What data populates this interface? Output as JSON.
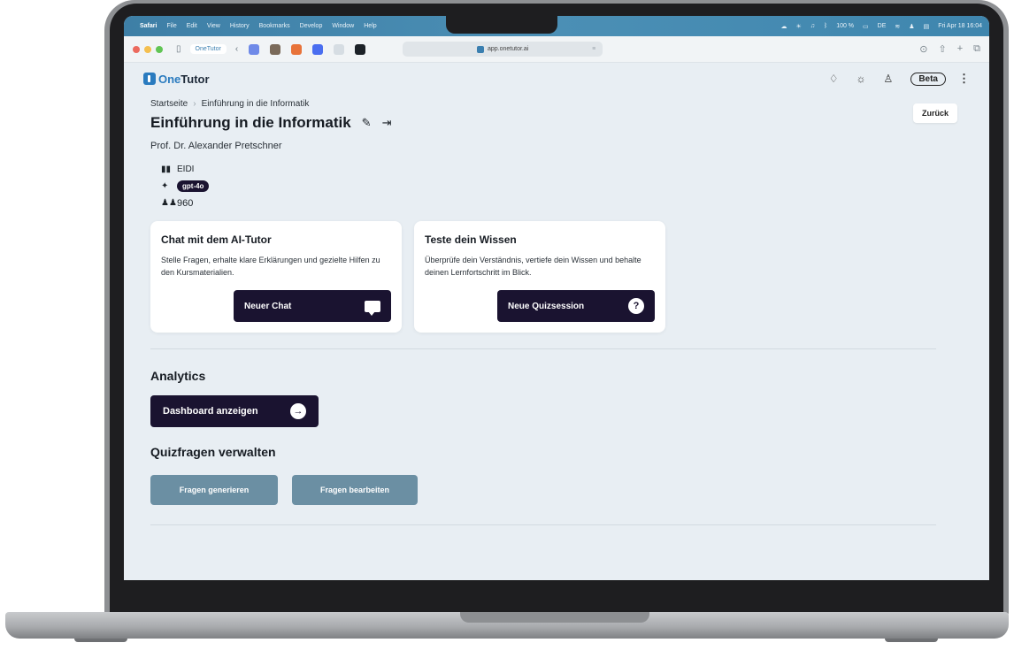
{
  "menubar": {
    "app": "Safari",
    "items": [
      "File",
      "Edit",
      "View",
      "History",
      "Bookmarks",
      "Develop",
      "Window",
      "Help"
    ],
    "battery": "100 %",
    "input_source": "DE",
    "datetime": "Fri Apr 18  16:04"
  },
  "browser": {
    "tab_group": "OneTutor",
    "url": "app.onetutor.ai"
  },
  "header": {
    "logo_part1": "One",
    "logo_part2": "Tutor",
    "beta": "Beta"
  },
  "breadcrumb": {
    "home": "Startseite",
    "current": "Einführung in die Informatik"
  },
  "course": {
    "title": "Einführung in die Informatik",
    "professor": "Prof. Dr. Alexander Pretschner",
    "code": "EIDI",
    "model": "gpt-4o",
    "students": "960"
  },
  "back_button": "Zurück",
  "cards": {
    "chat": {
      "title": "Chat mit dem AI-Tutor",
      "description": "Stelle Fragen, erhalte klare Erklärungen und gezielte Hilfen zu den Kursmaterialien.",
      "button": "Neuer Chat"
    },
    "quiz": {
      "title": "Teste dein Wissen",
      "description": "Überprüfe dein Verständnis, vertiefe dein Wissen und behalte deinen Lernfortschritt im Blick.",
      "button": "Neue Quizsession"
    }
  },
  "analytics": {
    "title": "Analytics",
    "button": "Dashboard anzeigen"
  },
  "quiz_admin": {
    "title": "Quizfragen verwalten",
    "generate": "Fragen generieren",
    "edit": "Fragen bearbeiten"
  },
  "colors": {
    "primary": "#1a1330",
    "secondary_button": "#6b8fa3",
    "brand": "#2a7bbf",
    "menubar": "#4b8fb5",
    "page_bg": "#e8eef3"
  }
}
